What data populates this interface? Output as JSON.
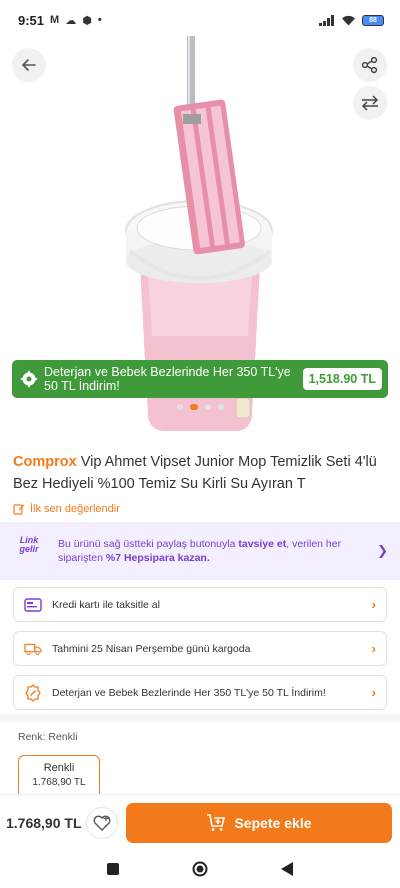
{
  "status": {
    "time": "9:51",
    "left_icons": [
      "M",
      "cloud",
      "box",
      "dot"
    ],
    "battery": "88"
  },
  "hero": {
    "back_icon": "arrow-left-icon",
    "share_icon": "share-icon",
    "compare_icon": "compare-arrows-icon",
    "promo": {
      "text": "Deterjan ve Bebek Bezlerinde Her 350 TL'ye 50 TL İndirim!",
      "price": "1,518.90 TL"
    },
    "dots_count": 5,
    "active_dot": 1
  },
  "product": {
    "brand": "Comprox",
    "title": "Vip Ahmet Vipset Junior Mop Temizlik Seti 4'lü Bez Hediyeli %100 Temiz Su Kirli Su Ayıran T",
    "review_cta": "İlk sen değerlendir"
  },
  "referral": {
    "logo_line1": "Link",
    "logo_line2": "gelir",
    "text_prefix": "Bu ürünü sağ üstteki paylaş butonuyla",
    "text_bold1": "tavsiye et",
    "text_middle": ", verilen her siparişten",
    "text_bold2": "%7 Hepsipara kazan."
  },
  "info_cards": [
    {
      "label": "Kredi kartı ile taksitle al",
      "icon": "credit-card-icon"
    },
    {
      "label": "Tahmini 25 Nisan Perşembe günü kargoda",
      "icon": "delivery-truck-icon"
    },
    {
      "label": "Deterjan ve Bebek Bezlerinde Her 350 TL'ye 50 TL İndirim!",
      "icon": "discount-icon"
    }
  ],
  "variant": {
    "label": "Renk: Renkli",
    "name": "Renkli",
    "price": "1.768,90 TL"
  },
  "bottom": {
    "price": "1.768,90 TL",
    "cart_label": "Sepete ekle"
  },
  "colors": {
    "accent": "#f27a1a",
    "promo_green": "#3f9b3a",
    "referral_purple": "#7b3fd0"
  }
}
